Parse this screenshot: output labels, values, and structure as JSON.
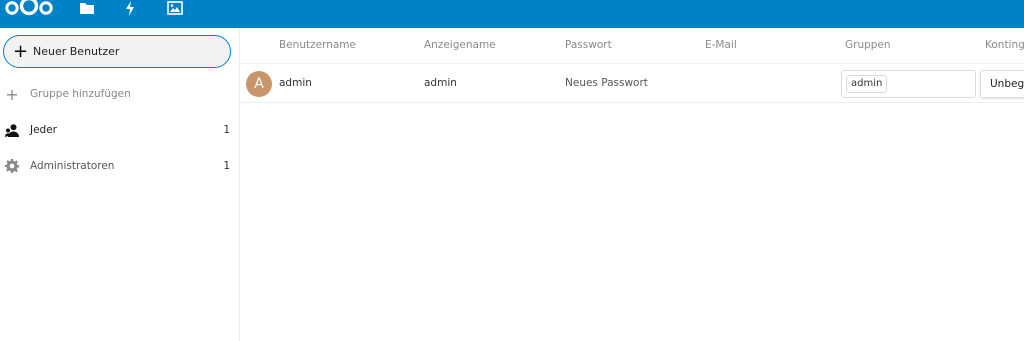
{
  "header": {
    "logo": "nextcloud-logo",
    "apps": [
      {
        "icon": "files-icon"
      },
      {
        "icon": "activity-icon"
      },
      {
        "icon": "gallery-icon"
      }
    ],
    "bg_color": "#0082c9"
  },
  "sidebar": {
    "new_user_label": "Neuer Benutzer",
    "add_group_label": "Gruppe hinzufügen",
    "groups": [
      {
        "label": "Jeder",
        "count": "1",
        "icon": "everyone-icon"
      },
      {
        "label": "Administratoren",
        "count": "1",
        "icon": "admin-gear-icon"
      }
    ]
  },
  "table": {
    "headers": [
      "Benutzername",
      "Anzeigename",
      "Passwort",
      "E-Mail",
      "Gruppen",
      "Kontingent"
    ],
    "rows": [
      {
        "avatar_letter": "A",
        "username": "admin",
        "display_name": "admin",
        "password": "Neues Passwort",
        "email": "",
        "group": "admin",
        "quota": "Unbegrenzt"
      }
    ]
  },
  "colors": {
    "accent": "#0082c9",
    "avatar": "#c9956a"
  }
}
